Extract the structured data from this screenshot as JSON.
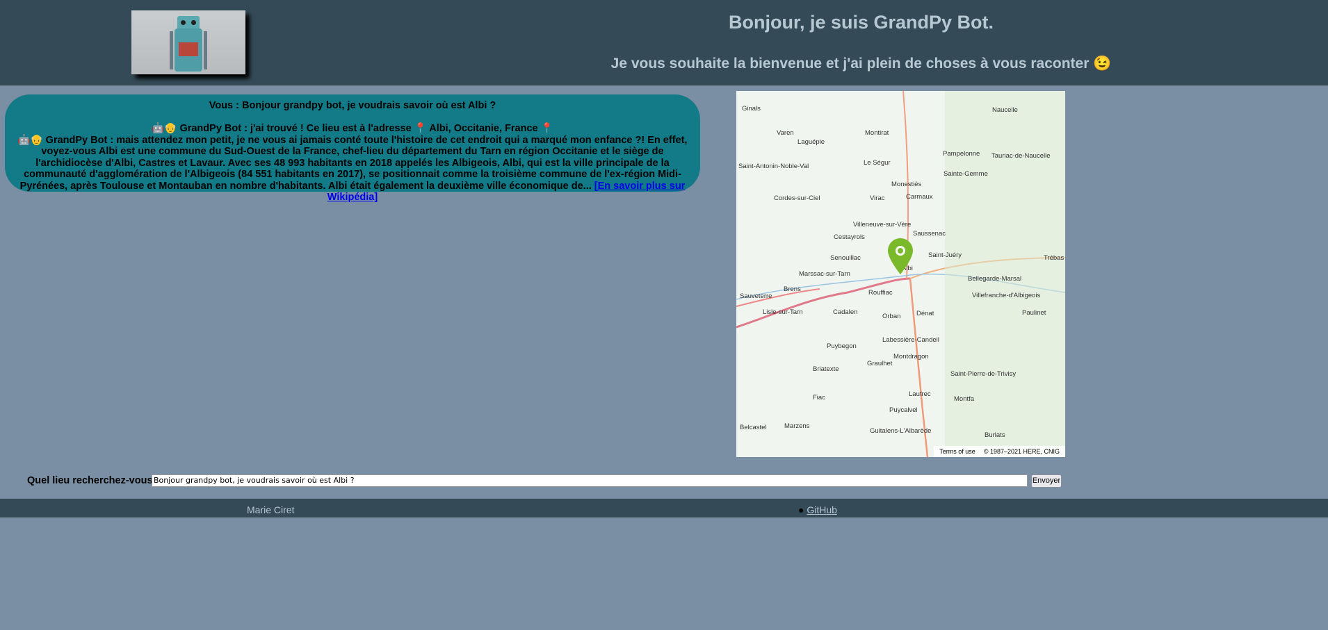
{
  "header": {
    "title": "Bonjour, je suis GrandPy Bot.",
    "subtitle": "Je vous souhaite la bienvenue et j'ai plein de choses à vous raconter 😉"
  },
  "chat": {
    "user_message": "Vous : Bonjour grandpy bot, je voudrais savoir où est Albi ?",
    "bot_address_prefix": "🤖👴 GrandPy Bot : j'ai trouvé ! Ce lieu est à l'adresse 📍 Albi, Occitanie, France 📍",
    "bot_story": "🤖👴 GrandPy Bot : mais attendez mon petit, je ne vous ai jamais conté toute l'histoire de cet endroit qui a marqué mon enfance ?! En effet, voyez-vous Albi est une commune du Sud-Ouest de la France, chef-lieu du département du Tarn en région Occitanie et le siège de l'archidiocèse d'Albi, Castres et Lavaur. Avec ses 48 993 habitants en 2018 appelés les Albigeois, Albi, qui est la ville principale de la communauté d'agglomération de l'Albigeois (84 551 habitants en 2017), se positionnait comme la troisième commune de l'ex-région Midi-Pyrénées, après Toulouse et Montauban en nombre d'habitants. Albi était également la deuxième ville économique de...",
    "wiki_link": "[En savoir plus sur Wikipédia]"
  },
  "map": {
    "places": [
      "Ginals",
      "Varen",
      "Montirat",
      "Laguépie",
      "Saint-Antonin-Noble-Val",
      "Le Ségur",
      "Pampelonne",
      "Tauriac-de-Naucelle",
      "Naucelle",
      "Sainte-Gemme",
      "Cordes-sur-Ciel",
      "Virac",
      "Monestiés",
      "Carmaux",
      "Villeneuve-sur-Vère",
      "Cestayrols",
      "Saussenac",
      "Senouillac",
      "Albi",
      "Saint-Juéry",
      "Marssac-sur-Tarn",
      "Brens",
      "Rouffiac",
      "Bellegarde-Marsal",
      "Lisle-sur-Tarn",
      "Cadalen",
      "Orban",
      "Dénat",
      "Villefranche-d'Albigeois",
      "Labessière-Candeil",
      "Puybegon",
      "Graulhet",
      "Montdragon",
      "Briatexte",
      "Saint-Pierre-de-Trivisy",
      "Fiac",
      "Lautrec",
      "Montfa",
      "Puycalvel",
      "Belcastel",
      "Marzens",
      "Guitalens-L'Albarède",
      "Burlats",
      "Sauveterre",
      "Trébas",
      "Paulinet"
    ],
    "terms": "Terms of use",
    "copyright": "© 1987–2021 HERE, CNIG",
    "marker_color": "#7ab929"
  },
  "form": {
    "label": "Quel lieu recherchez-vous ?",
    "value": "Bonjour grandpy bot, je voudrais savoir où est Albi ?",
    "submit": "Envoyer"
  },
  "footer": {
    "author": "Marie Ciret",
    "github": "GitHub"
  }
}
